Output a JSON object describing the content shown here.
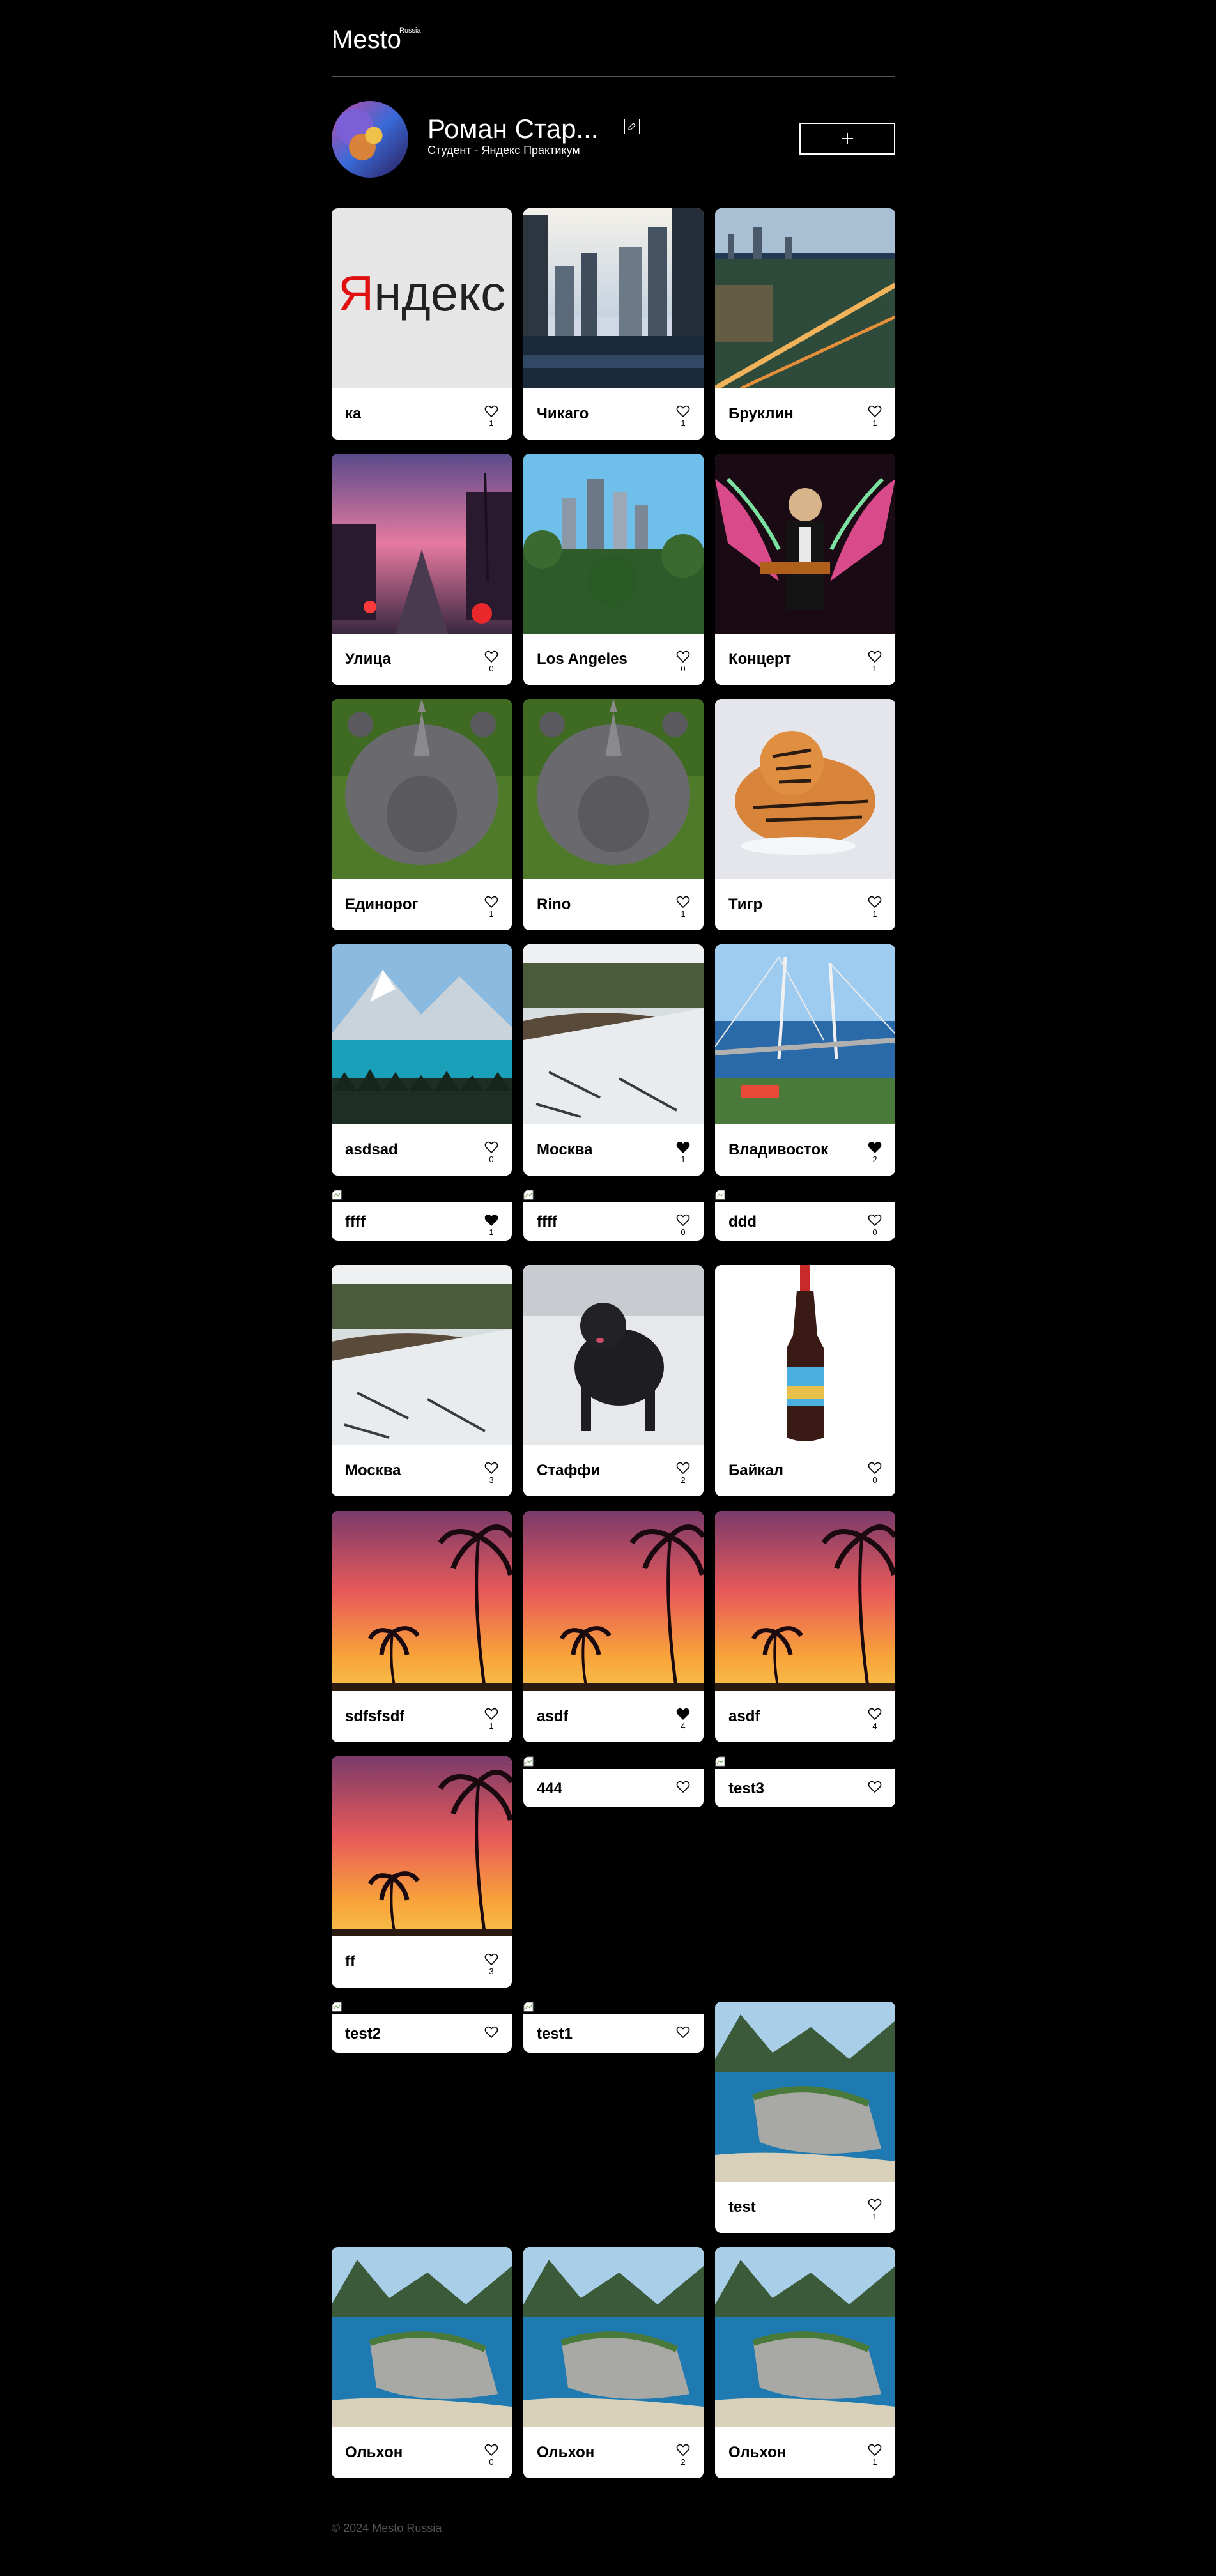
{
  "header": {
    "logo": "Mesto",
    "logo_sup": "Russia"
  },
  "profile": {
    "name": "Роман Стар...",
    "about": "Студент - Яндекс Практикум"
  },
  "cards": [
    {
      "title": "ка",
      "likes": "1",
      "liked": false,
      "image": "yandex"
    },
    {
      "title": "Чикаго",
      "likes": "1",
      "liked": false,
      "image": "chicago"
    },
    {
      "title": "Бруклин",
      "likes": "1",
      "liked": false,
      "image": "brooklyn"
    },
    {
      "title": "Улица",
      "likes": "0",
      "liked": false,
      "image": "street"
    },
    {
      "title": "Los Angeles",
      "likes": "0",
      "liked": false,
      "image": "la"
    },
    {
      "title": "Концерт",
      "likes": "1",
      "liked": false,
      "image": "concert"
    },
    {
      "title": "Единорог",
      "likes": "1",
      "liked": false,
      "image": "rhino"
    },
    {
      "title": "Rino",
      "likes": "1",
      "liked": false,
      "image": "rhino"
    },
    {
      "title": "Тигр",
      "likes": "1",
      "liked": false,
      "image": "tiger"
    },
    {
      "title": "asdsad",
      "likes": "0",
      "liked": false,
      "image": "lake"
    },
    {
      "title": "Москва",
      "likes": "1",
      "liked": true,
      "image": "snowriver"
    },
    {
      "title": "Владивосток",
      "likes": "2",
      "liked": true,
      "image": "bridge"
    },
    {
      "title": "ffff",
      "likes": "1",
      "liked": true,
      "image": "broken"
    },
    {
      "title": "ffff",
      "likes": "0",
      "liked": false,
      "image": "broken"
    },
    {
      "title": "ddd",
      "likes": "0",
      "liked": false,
      "image": "broken"
    },
    {
      "title": "Москва",
      "likes": "3",
      "liked": false,
      "image": "snowriver"
    },
    {
      "title": "Стаффи",
      "likes": "2",
      "liked": false,
      "image": "dog"
    },
    {
      "title": "Байкал",
      "likes": "0",
      "liked": false,
      "image": "bottle"
    },
    {
      "title": "sdfsfsdf",
      "likes": "1",
      "liked": false,
      "image": "sunset"
    },
    {
      "title": "asdf",
      "likes": "4",
      "liked": true,
      "image": "sunset"
    },
    {
      "title": "asdf",
      "likes": "4",
      "liked": false,
      "image": "sunset"
    },
    {
      "title": "ff",
      "likes": "3",
      "liked": false,
      "image": "sunset"
    },
    {
      "title": "444",
      "likes": "",
      "liked": false,
      "image": "broken"
    },
    {
      "title": "test3",
      "likes": "",
      "liked": false,
      "image": "broken"
    },
    {
      "title": "test2",
      "likes": "",
      "liked": false,
      "image": "broken"
    },
    {
      "title": "test1",
      "likes": "",
      "liked": false,
      "image": "broken"
    },
    {
      "title": "test",
      "likes": "1",
      "liked": false,
      "image": "olkhon"
    },
    {
      "title": "Ольхон",
      "likes": "0",
      "liked": false,
      "image": "olkhon"
    },
    {
      "title": "Ольхон",
      "likes": "2",
      "liked": false,
      "image": "olkhon"
    },
    {
      "title": "Ольхон",
      "likes": "1",
      "liked": false,
      "image": "olkhon"
    }
  ],
  "footer": {
    "text": "© 2024 Mesto Russia"
  }
}
